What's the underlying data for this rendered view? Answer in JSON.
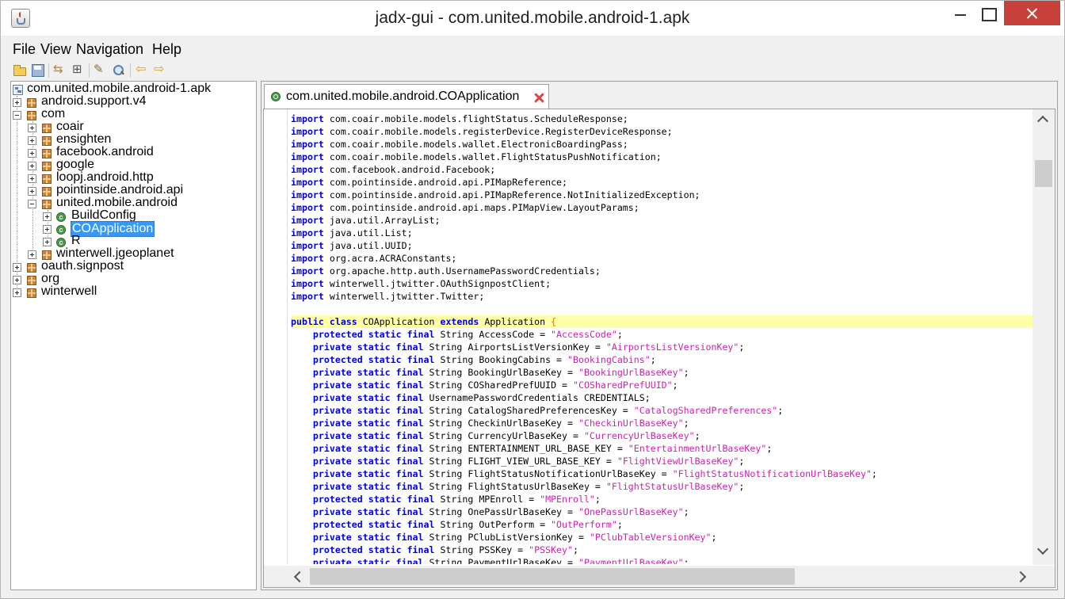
{
  "window": {
    "title": "jadx-gui - com.united.mobile.android-1.apk"
  },
  "menu": {
    "items": [
      "File",
      "View",
      "Navigation",
      "Help"
    ]
  },
  "toolbar": {
    "icons": [
      "open-folder-icon",
      "save-all-icon",
      "sync-icon",
      "flatten-tree-icon",
      "decompile-icon",
      "search-icon",
      "back-icon",
      "forward-icon"
    ]
  },
  "tree": {
    "root": "com.united.mobile.android-1.apk",
    "nodes": [
      {
        "label": "android.support.v4",
        "type": "package"
      },
      {
        "label": "com",
        "type": "package"
      },
      {
        "label": "coair",
        "type": "package"
      },
      {
        "label": "ensighten",
        "type": "package"
      },
      {
        "label": "facebook.android",
        "type": "package"
      },
      {
        "label": "google",
        "type": "package"
      },
      {
        "label": "loopj.android.http",
        "type": "package"
      },
      {
        "label": "pointinside.android.api",
        "type": "package"
      },
      {
        "label": "united.mobile.android",
        "type": "package"
      },
      {
        "label": "BuildConfig",
        "type": "class"
      },
      {
        "label": "COApplication",
        "type": "class",
        "selected": true
      },
      {
        "label": "R",
        "type": "class"
      },
      {
        "label": "winterwell.jgeoplanet",
        "type": "package"
      },
      {
        "label": "oauth.signpost",
        "type": "package"
      },
      {
        "label": "org",
        "type": "package"
      },
      {
        "label": "winterwell",
        "type": "package"
      }
    ]
  },
  "editor": {
    "tab_label": "com.united.mobile.android.COApplication",
    "lines": [
      [
        [
          "kw",
          "import"
        ],
        [
          "t",
          " com.coair.mobile.models.flightStatus.ScheduleResponse;"
        ]
      ],
      [
        [
          "kw",
          "import"
        ],
        [
          "t",
          " com.coair.mobile.models.registerDevice.RegisterDeviceResponse;"
        ]
      ],
      [
        [
          "kw",
          "import"
        ],
        [
          "t",
          " com.coair.mobile.models.wallet.ElectronicBoardingPass;"
        ]
      ],
      [
        [
          "kw",
          "import"
        ],
        [
          "t",
          " com.coair.mobile.models.wallet.FlightStatusPushNotification;"
        ]
      ],
      [
        [
          "kw",
          "import"
        ],
        [
          "t",
          " com.facebook.android.Facebook;"
        ]
      ],
      [
        [
          "kw",
          "import"
        ],
        [
          "t",
          " com.pointinside.android.api.PIMapReference;"
        ]
      ],
      [
        [
          "kw",
          "import"
        ],
        [
          "t",
          " com.pointinside.android.api.PIMapReference.NotInitializedException;"
        ]
      ],
      [
        [
          "kw",
          "import"
        ],
        [
          "t",
          " com.pointinside.android.api.maps.PIMapView.LayoutParams;"
        ]
      ],
      [
        [
          "kw",
          "import"
        ],
        [
          "t",
          " java.util.ArrayList;"
        ]
      ],
      [
        [
          "kw",
          "import"
        ],
        [
          "t",
          " java.util.List;"
        ]
      ],
      [
        [
          "kw",
          "import"
        ],
        [
          "t",
          " java.util.UUID;"
        ]
      ],
      [
        [
          "kw",
          "import"
        ],
        [
          "t",
          " org.acra.ACRAConstants;"
        ]
      ],
      [
        [
          "kw",
          "import"
        ],
        [
          "t",
          " org.apache.http.auth.UsernamePasswordCredentials;"
        ]
      ],
      [
        [
          "kw",
          "import"
        ],
        [
          "t",
          " winterwell.jtwitter.OAuthSignpostClient;"
        ]
      ],
      [
        [
          "kw",
          "import"
        ],
        [
          "t",
          " winterwell.jtwitter.Twitter;"
        ]
      ],
      [],
      [
        [
          "kw",
          "public class"
        ],
        [
          "t",
          " COApplication "
        ],
        [
          "kw",
          "extends"
        ],
        [
          "t",
          " Application "
        ],
        [
          "paren",
          "{"
        ]
      ],
      [
        [
          "t",
          "    "
        ],
        [
          "kw",
          "protected static final"
        ],
        [
          "t",
          " String AccessCode = "
        ],
        [
          "str",
          "\"AccessCode\""
        ],
        [
          "t",
          ";"
        ]
      ],
      [
        [
          "t",
          "    "
        ],
        [
          "kw",
          "private static final"
        ],
        [
          "t",
          " String AirportsListVersionKey = "
        ],
        [
          "str",
          "\"AirportsListVersionKey\""
        ],
        [
          "t",
          ";"
        ]
      ],
      [
        [
          "t",
          "    "
        ],
        [
          "kw",
          "protected static final"
        ],
        [
          "t",
          " String BookingCabins = "
        ],
        [
          "str",
          "\"BookingCabins\""
        ],
        [
          "t",
          ";"
        ]
      ],
      [
        [
          "t",
          "    "
        ],
        [
          "kw",
          "private static final"
        ],
        [
          "t",
          " String BookingUrlBaseKey = "
        ],
        [
          "str",
          "\"BookingUrlBaseKey\""
        ],
        [
          "t",
          ";"
        ]
      ],
      [
        [
          "t",
          "    "
        ],
        [
          "kw",
          "private static final"
        ],
        [
          "t",
          " String COSharedPrefUUID = "
        ],
        [
          "str",
          "\"COSharedPrefUUID\""
        ],
        [
          "t",
          ";"
        ]
      ],
      [
        [
          "t",
          "    "
        ],
        [
          "kw",
          "private static final"
        ],
        [
          "t",
          " UsernamePasswordCredentials CREDENTIALS;"
        ]
      ],
      [
        [
          "t",
          "    "
        ],
        [
          "kw",
          "private static final"
        ],
        [
          "t",
          " String CatalogSharedPreferencesKey = "
        ],
        [
          "str",
          "\"CatalogSharedPreferences\""
        ],
        [
          "t",
          ";"
        ]
      ],
      [
        [
          "t",
          "    "
        ],
        [
          "kw",
          "private static final"
        ],
        [
          "t",
          " String CheckinUrlBaseKey = "
        ],
        [
          "str",
          "\"CheckinUrlBaseKey\""
        ],
        [
          "t",
          ";"
        ]
      ],
      [
        [
          "t",
          "    "
        ],
        [
          "kw",
          "private static final"
        ],
        [
          "t",
          " String CurrencyUrlBaseKey = "
        ],
        [
          "str",
          "\"CurrencyUrlBaseKey\""
        ],
        [
          "t",
          ";"
        ]
      ],
      [
        [
          "t",
          "    "
        ],
        [
          "kw",
          "private static final"
        ],
        [
          "t",
          " String ENTERTAINMENT_URL_BASE_KEY = "
        ],
        [
          "str",
          "\"EntertainmentUrlBaseKey\""
        ],
        [
          "t",
          ";"
        ]
      ],
      [
        [
          "t",
          "    "
        ],
        [
          "kw",
          "private static final"
        ],
        [
          "t",
          " String FLIGHT_VIEW_URL_BASE_KEY = "
        ],
        [
          "str",
          "\"FlightViewUrlBaseKey\""
        ],
        [
          "t",
          ";"
        ]
      ],
      [
        [
          "t",
          "    "
        ],
        [
          "kw",
          "private static final"
        ],
        [
          "t",
          " String FlightStatusNotificationUrlBaseKey = "
        ],
        [
          "str",
          "\"FlightStatusNotificationUrlBaseKey\""
        ],
        [
          "t",
          ";"
        ]
      ],
      [
        [
          "t",
          "    "
        ],
        [
          "kw",
          "private static final"
        ],
        [
          "t",
          " String FlightStatusUrlBaseKey = "
        ],
        [
          "str",
          "\"FlightStatusUrlBaseKey\""
        ],
        [
          "t",
          ";"
        ]
      ],
      [
        [
          "t",
          "    "
        ],
        [
          "kw",
          "protected static final"
        ],
        [
          "t",
          " String MPEnroll = "
        ],
        [
          "str",
          "\"MPEnroll\""
        ],
        [
          "t",
          ";"
        ]
      ],
      [
        [
          "t",
          "    "
        ],
        [
          "kw",
          "private static final"
        ],
        [
          "t",
          " String OnePassUrlBaseKey = "
        ],
        [
          "str",
          "\"OnePassUrlBaseKey\""
        ],
        [
          "t",
          ";"
        ]
      ],
      [
        [
          "t",
          "    "
        ],
        [
          "kw",
          "protected static final"
        ],
        [
          "t",
          " String OutPerform = "
        ],
        [
          "str",
          "\"OutPerform\""
        ],
        [
          "t",
          ";"
        ]
      ],
      [
        [
          "t",
          "    "
        ],
        [
          "kw",
          "private static final"
        ],
        [
          "t",
          " String PClubListVersionKey = "
        ],
        [
          "str",
          "\"PClubTableVersionKey\""
        ],
        [
          "t",
          ";"
        ]
      ],
      [
        [
          "t",
          "    "
        ],
        [
          "kw",
          "protected static final"
        ],
        [
          "t",
          " String PSSKey = "
        ],
        [
          "str",
          "\"PSSKey\""
        ],
        [
          "t",
          ";"
        ]
      ],
      [
        [
          "t",
          "    "
        ],
        [
          "kw",
          "private static final"
        ],
        [
          "t",
          " String PaymentUrlBaseKey = "
        ],
        [
          "str",
          "\"PaymentUrlBaseKey\""
        ],
        [
          "t",
          ";"
        ]
      ]
    ],
    "highlighted_line": 16
  }
}
